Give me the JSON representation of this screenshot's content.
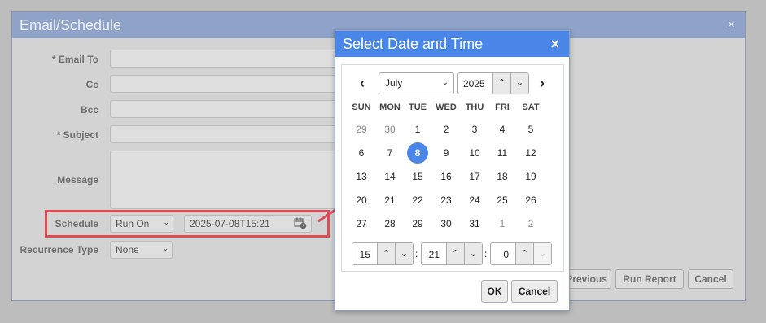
{
  "dialog": {
    "title": "Email/Schedule",
    "close_icon": "×",
    "fields": {
      "email_to": "* Email To",
      "cc": "Cc",
      "bcc": "Bcc",
      "subject": "* Subject",
      "message": "Message",
      "schedule": "Schedule",
      "recurrence_type": "Recurrence Type"
    },
    "schedule_mode": "Run On",
    "schedule_value": "2025-07-08T15:21",
    "recurrence_value": "None",
    "buttons": {
      "previous": "Previous",
      "run_report": "Run Report",
      "cancel": "Cancel"
    }
  },
  "picker": {
    "title": "Select Date and Time",
    "close_icon": "×",
    "prev_icon": "‹",
    "next_icon": "›",
    "month": "July",
    "year": "2025",
    "weekdays": [
      "SUN",
      "MON",
      "TUE",
      "WED",
      "THU",
      "FRI",
      "SAT"
    ],
    "weeks": [
      [
        "29",
        "30",
        "1",
        "2",
        "3",
        "4",
        "5"
      ],
      [
        "6",
        "7",
        "8",
        "9",
        "10",
        "11",
        "12"
      ],
      [
        "13",
        "14",
        "15",
        "16",
        "17",
        "18",
        "19"
      ],
      [
        "20",
        "21",
        "22",
        "23",
        "24",
        "25",
        "26"
      ],
      [
        "27",
        "28",
        "29",
        "30",
        "31",
        "1",
        "2"
      ]
    ],
    "selected_day": "8",
    "time": {
      "hour": "15",
      "minute": "21",
      "second": "0",
      "separator": ":"
    },
    "ok_label": "OK",
    "cancel_label": "Cancel"
  },
  "icons": {
    "up": "⌃",
    "down": "⌄",
    "chevron": "⌄"
  },
  "colors": {
    "accent": "#4a86e8",
    "highlight": "#e04c55"
  }
}
